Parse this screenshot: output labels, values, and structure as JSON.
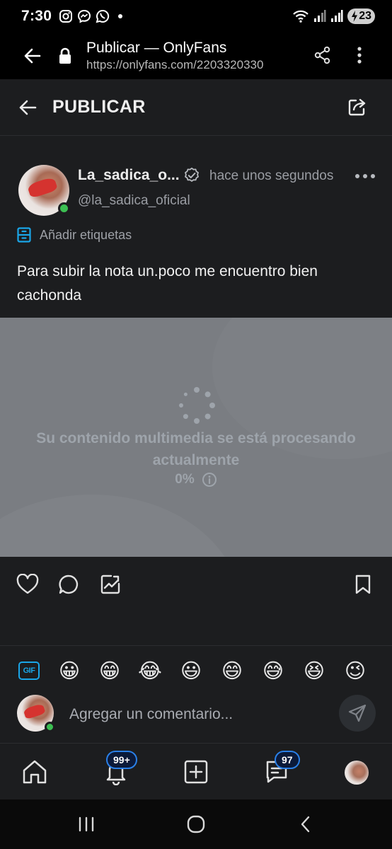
{
  "status_bar": {
    "time": "7:30",
    "battery": "23",
    "icons": [
      "instagram-icon",
      "messenger-icon",
      "whatsapp-icon",
      "wifi-icon",
      "signal-icon",
      "signal-icon",
      "battery-charging-icon"
    ]
  },
  "browser": {
    "title": "Publicar — OnlyFans",
    "url": "https://onlyfans.com/2203320330"
  },
  "header": {
    "title": "PUBLICAR"
  },
  "post": {
    "name": "La_sadica_o...",
    "time": "hace unos segundos",
    "handle": "@la_sadica_oficial",
    "tags_label": "Añadir etiquetas",
    "text": "Para subir la nota un.poco me encuentro bien cachonda"
  },
  "media": {
    "processing_text": "Su contenido multimedia se está procesando actualmente",
    "progress": "0%"
  },
  "emoji_bar": {
    "gif_label": "GIF",
    "emojis": [
      "😀",
      "😁",
      "😂",
      "😃",
      "😄",
      "😅",
      "😆",
      "😉"
    ]
  },
  "comment": {
    "placeholder": "Agregar un comentario..."
  },
  "bottom_nav": {
    "notifications_badge": "99+",
    "messages_badge": "97"
  },
  "colors": {
    "background": "#1c1d1f",
    "accent": "#1aa6e8",
    "online": "#3cbf52",
    "media_overlay": "#7a7d82"
  }
}
